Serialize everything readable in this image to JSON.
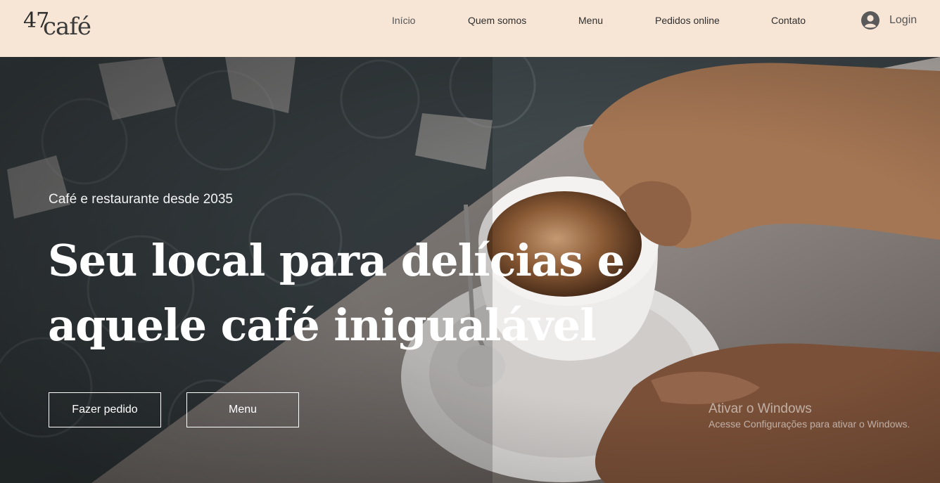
{
  "header": {
    "logo": {
      "number": "47",
      "word": "café"
    },
    "nav": [
      {
        "label": "Início"
      },
      {
        "label": "Quem somos"
      },
      {
        "label": "Menu"
      },
      {
        "label": "Pedidos online"
      },
      {
        "label": "Contato"
      }
    ],
    "login_label": "Login",
    "colors": {
      "background": "#f7e6d6",
      "text": "#2f2f2f"
    }
  },
  "hero": {
    "kicker": "Café e restaurante desde 2035",
    "headline_line1": "Seu local para delícias e",
    "headline_line2": "aquele café inigualável",
    "buttons": {
      "order_label": "Fazer pedido",
      "menu_label": "Menu"
    }
  },
  "windows_watermark": {
    "title": "Ativar o Windows",
    "subtitle": "Acesse Configurações para ativar o Windows."
  },
  "icons": {
    "login": "user-circle-icon"
  }
}
